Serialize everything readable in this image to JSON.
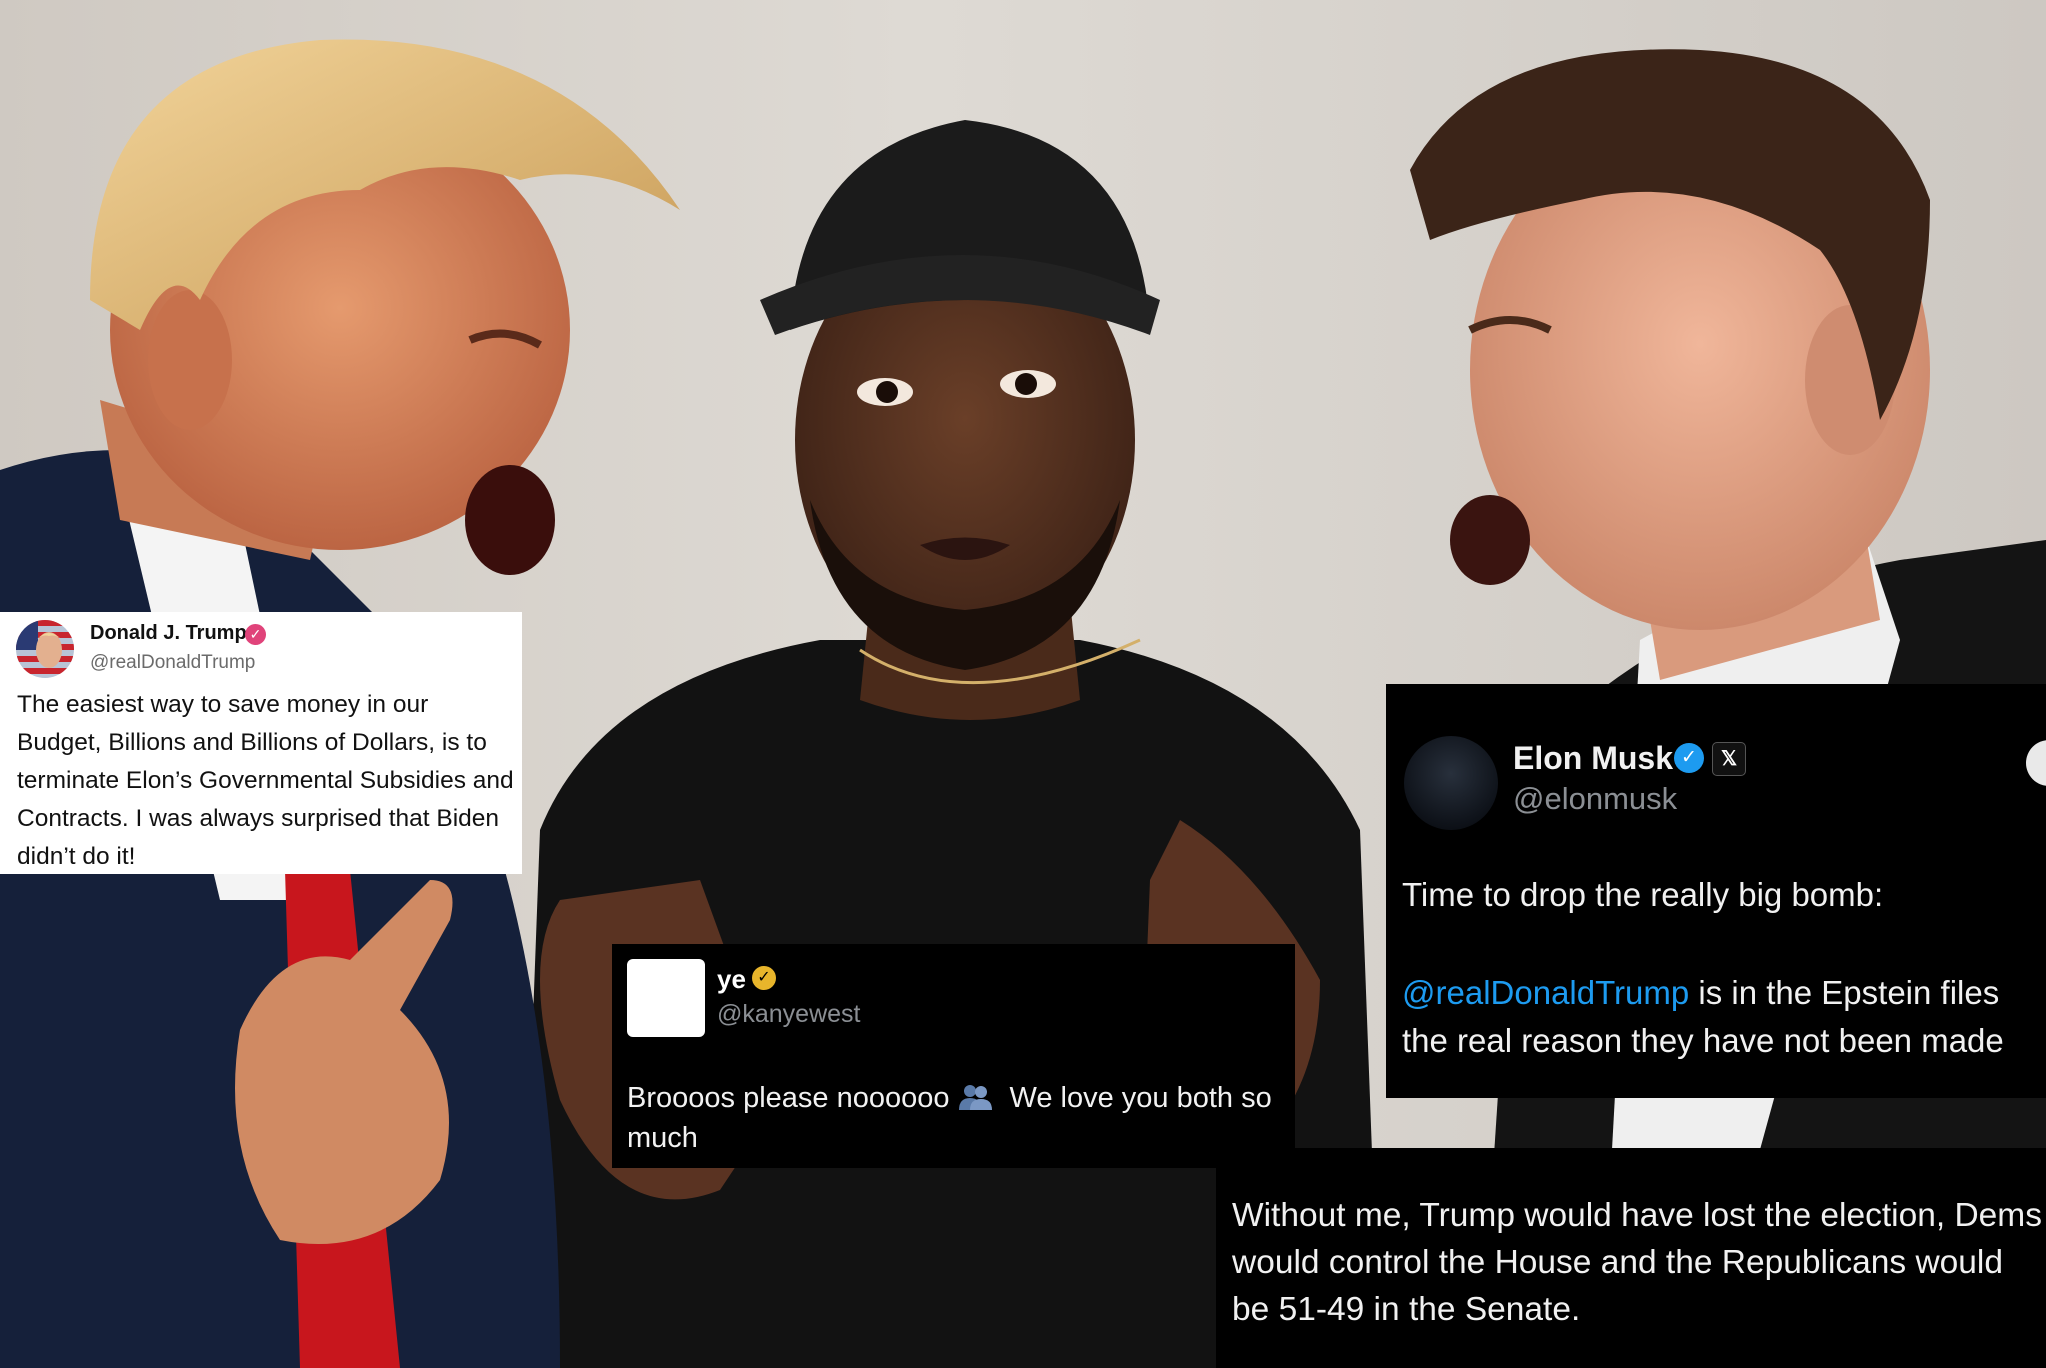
{
  "scene": {
    "description_icon": "photo-composite"
  },
  "tweets": {
    "trump": {
      "name": "Donald J. Trump",
      "handle": "@realDonaldTrump",
      "verified_icon": "verified-badge-icon",
      "verified_color": "#e0437a",
      "text": "The easiest way to save money in our Budget, Billions and Billions of Dollars, is to terminate Elon’s Governmental Subsidies and Contracts. I was always surprised that Biden didn’t do it!"
    },
    "ye": {
      "name": "ye",
      "handle": "@kanyewest",
      "verified_icon": "verified-badge-icon",
      "verified_color": "#e8b52b",
      "text_before": "Broooos please noooooo",
      "emoji_icon": "two-people-emoji-icon",
      "text_after": "We love you both so much"
    },
    "elon_1": {
      "name": "Elon Musk",
      "handle": "@elonmusk",
      "verified_icon": "verified-badge-icon",
      "verified_color": "#1d9bf0",
      "x_badge": "𝕏",
      "line1": "Time to drop the really big bomb:",
      "mention": "@realDonaldTrump",
      "line2_rest": " is in the Epstein files",
      "line3": "the real reason they have not been made"
    },
    "elon_2": {
      "text": "Without me, Trump would have lost the election, Dems would control the House and the Republicans would be 51-49 in the Senate."
    }
  }
}
